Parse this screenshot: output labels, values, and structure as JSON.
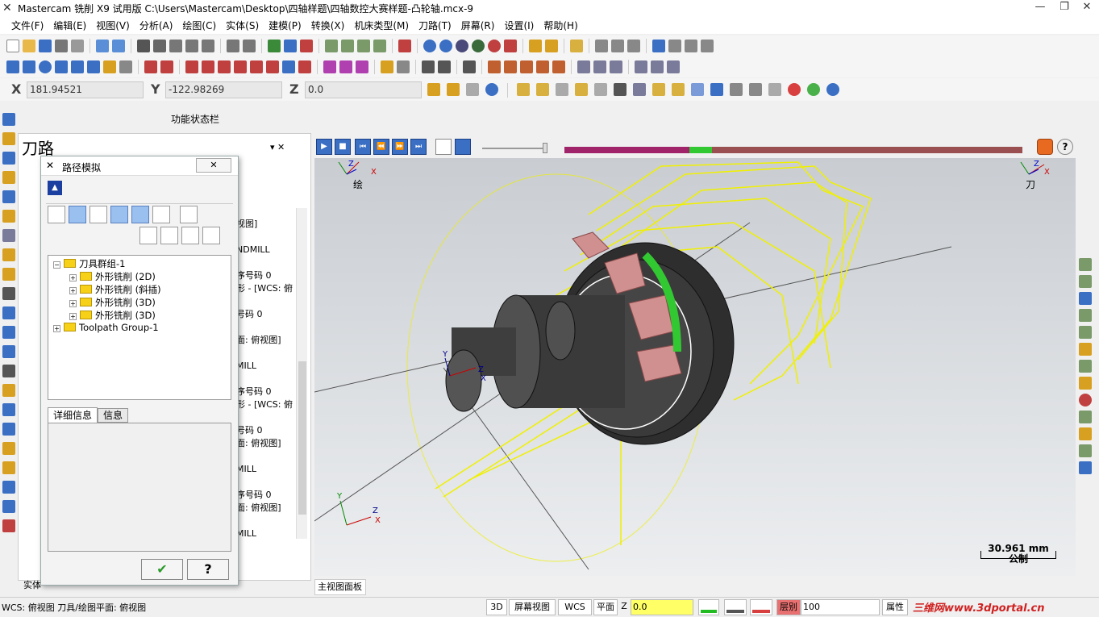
{
  "window": {
    "title": "Mastercam 铣削 X9 试用版  C:\\Users\\Mastercam\\Desktop\\四轴样题\\四轴数控大赛样题-凸轮轴.mcx-9",
    "minimize": "—",
    "restore": "❐",
    "close": "✕"
  },
  "menu": [
    "文件(F)",
    "编辑(E)",
    "视图(V)",
    "分析(A)",
    "绘图(C)",
    "实体(S)",
    "建模(P)",
    "转换(X)",
    "机床类型(M)",
    "刀路(T)",
    "屏幕(R)",
    "设置(I)",
    "帮助(H)"
  ],
  "coords": {
    "x_label": "X",
    "x_value": "181.94521",
    "y_label": "Y",
    "y_value": "-122.98269",
    "z_label": "Z",
    "z_value": "0.0"
  },
  "function_bar": "功能状态栏",
  "toolpath_panel": {
    "title": "刀路",
    "lines": [
      "视图]",
      "NDMILL",
      "序号码 0",
      "形 - [WCS: 俯",
      "号码 0",
      "面: 俯视图]",
      "MILL",
      "序号码 0",
      "形 - [WCS: 俯",
      "号码 0",
      "面: 俯视图]",
      "MILL",
      "序号码 0",
      "面: 俯视图]",
      "MILL"
    ]
  },
  "dialog": {
    "title": "路径模拟",
    "close": "✕",
    "tabs": [
      "详细信息",
      "信息"
    ],
    "tree": [
      {
        "label": "刀具群组-1",
        "level": 0,
        "expand": "−"
      },
      {
        "label": "外形铣削 (2D)",
        "level": 1,
        "expand": "+"
      },
      {
        "label": "外形铣削 (斜插)",
        "level": 1,
        "expand": "+"
      },
      {
        "label": "外形铣削 (3D)",
        "level": 1,
        "expand": "+"
      },
      {
        "label": "外形铣削 (3D)",
        "level": 1,
        "expand": "+"
      },
      {
        "label": "Toolpath Group-1",
        "level": 0,
        "expand": "+"
      }
    ],
    "ok": "✔",
    "help": "?"
  },
  "viewport": {
    "left_axis_label": "绘",
    "right_axis_label": "刀",
    "scale_value": "30.961 mm",
    "scale_unit": "公制",
    "panel_tab": "主视图面板"
  },
  "left_tabs": {
    "solid": "实体"
  },
  "statusbar": {
    "wcs_text": "WCS: 俯视图  刀具/绘图平面: 俯视图",
    "btn_3d": "3D",
    "screen_view": "屏幕视图",
    "wcs": "WCS",
    "plane": "平面",
    "z": "Z",
    "z_value": "0.0",
    "level": "层别",
    "level_value": "100",
    "attributes": "属性",
    "watermark": "三维网www.3dportal.cn"
  },
  "colors": {
    "timeline_magenta": "#a0246a",
    "timeline_green": "#32c832",
    "timeline_brown": "#9a5050",
    "yellow_path": "#f0f000",
    "accent_blue": "#1f5fbf"
  }
}
